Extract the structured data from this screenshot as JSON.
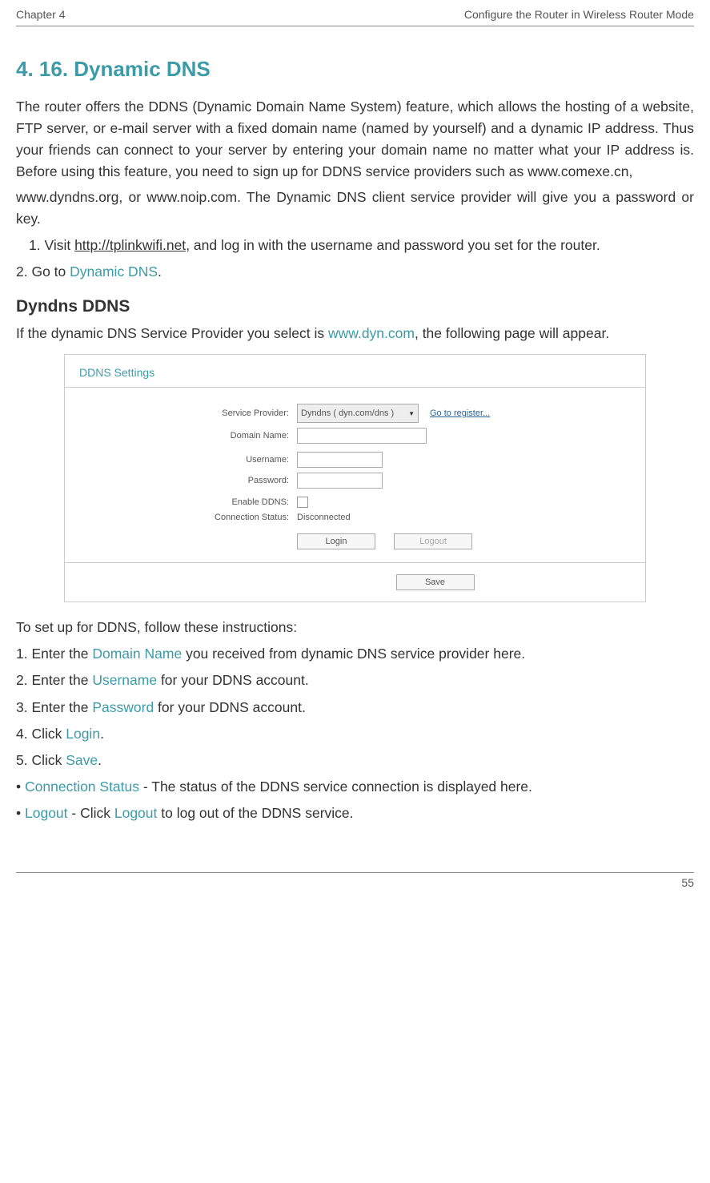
{
  "header": {
    "chapter": "Chapter 4",
    "title": "Configure the Router in Wireless Router Mode"
  },
  "section": {
    "num_title": "4. 16.   Dynamic DNS"
  },
  "para1": "The router offers the DDNS (Dynamic Domain Name System) feature, which allows the hosting of a website, FTP server, or e-mail server with a fixed domain name (named by yourself) and a dynamic IP address. Thus your friends can connect to your server by entering your domain name no matter what your IP address is. Before using this feature, you need to sign up for DDNS service providers such as www.comexe.cn,",
  "para2": "www.dyndns.org, or www.noip.com. The Dynamic DNS client service provider will give you a password or key.",
  "step1_pre": "1. Visit ",
  "step1_link": "http://tplinkwifi.net",
  "step1_post": ", and log in with the username and password you set for the router.",
  "step2_pre": "2. Go to ",
  "step2_teal": "Dynamic DNS",
  "step2_post": ".",
  "sub_heading": "Dyndns DDNS",
  "para3_pre": "If the dynamic DNS Service Provider you select is ",
  "para3_teal": "www.dyn.com",
  "para3_post": ", the following page will appear.",
  "shot": {
    "title": "DDNS Settings",
    "labels": {
      "provider": "Service Provider:",
      "domain": "Domain Name:",
      "username": "Username:",
      "password": "Password:",
      "enable": "Enable DDNS:",
      "status": "Connection Status:"
    },
    "select_value": "Dyndns ( dyn.com/dns )",
    "register": "Go to register...",
    "status_value": "Disconnected",
    "login_btn": "Login",
    "logout_btn": "Logout",
    "save_btn": "Save"
  },
  "instr_intro": "To set up for DDNS, follow these instructions:",
  "i1_pre": "1. Enter the ",
  "i1_teal": "Domain Name",
  "i1_post": " you received from dynamic DNS service provider here.",
  "i2_pre": "2. Enter the ",
  "i2_teal": "Username",
  "i2_post": " for your DDNS account.",
  "i3_pre": "3. Enter the ",
  "i3_teal": "Password",
  "i3_post": " for your DDNS account.",
  "i4_pre": "4. Click ",
  "i4_teal": "Login",
  "i4_post": ".",
  "i5_pre": "5. Click ",
  "i5_teal": "Save",
  "i5_post": ".",
  "b1_pre": "•  ",
  "b1_teal": "Connection Status",
  "b1_post": " - The status of the DDNS service connection is displayed here.",
  "b2_pre": "•  ",
  "b2_teal1": "Logout",
  "b2_mid": " - Click ",
  "b2_teal2": "Logout",
  "b2_post": " to log out of the DDNS service.",
  "page_num": "55"
}
